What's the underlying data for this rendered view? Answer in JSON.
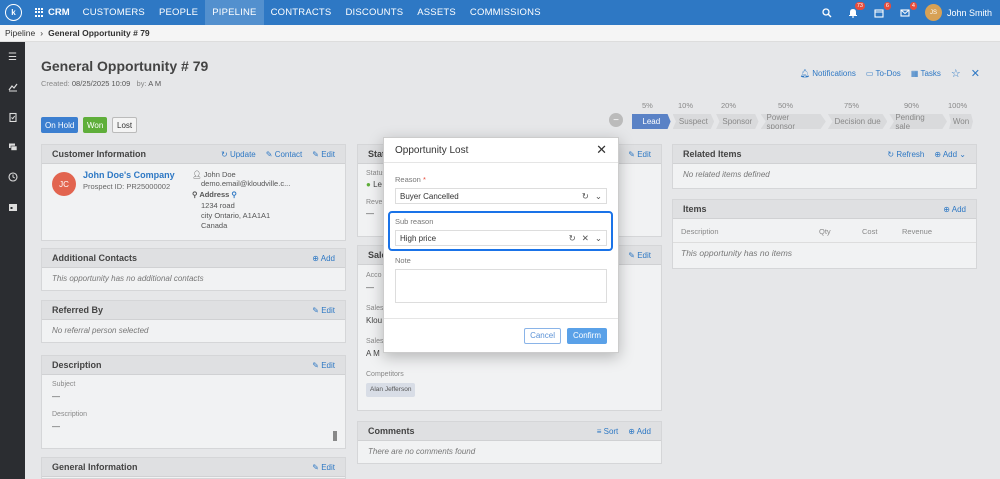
{
  "nav": {
    "logo": "k",
    "brand": "CRM",
    "items": [
      "CUSTOMERS",
      "PEOPLE",
      "PIPELINE",
      "CONTRACTS",
      "DISCOUNTS",
      "ASSETS",
      "COMMISSIONS"
    ],
    "active": "PIPELINE",
    "badges": {
      "notifications": "73",
      "tasks": "6",
      "messages": "4"
    },
    "user_initials": "JS",
    "user_name": "John Smith"
  },
  "breadcrumb": {
    "root": "Pipeline",
    "current": "General Opportunity # 79"
  },
  "header": {
    "title": "General Opportunity # 79",
    "created_label": "Created:",
    "created_date": "08/25/2025 10:09",
    "by_label": "by:",
    "by_user": "A M",
    "actions": {
      "notifications": "Notifications",
      "todos": "To-Dos",
      "tasks": "Tasks"
    }
  },
  "status_buttons": {
    "on_hold": "On Hold",
    "won": "Won",
    "lost": "Lost"
  },
  "stages": {
    "percents": [
      "5%",
      "10%",
      "20%",
      "50%",
      "75%",
      "90%",
      "100%"
    ],
    "labels": [
      "Lead",
      "Suspect",
      "Sponsor",
      "Power sponsor",
      "Decision due",
      "Pending sale",
      "Won"
    ]
  },
  "customer": {
    "title": "Customer Information",
    "update": "Update",
    "contact": "Contact",
    "edit": "Edit",
    "initials": "JC",
    "company": "John Doe's Company",
    "prospect": "Prospect ID: PR25000002",
    "person": "John Doe",
    "email": "demo.email@kloudville.c...",
    "address_label": "Address",
    "address_lines": [
      "1234 road",
      "city Ontario, A1A1A1",
      "Canada"
    ]
  },
  "additional_contacts": {
    "title": "Additional Contacts",
    "add": "Add",
    "empty": "This opportunity has no additional contacts"
  },
  "referred_by": {
    "title": "Referred By",
    "edit": "Edit",
    "empty": "No referral person selected"
  },
  "description": {
    "title": "Description",
    "edit": "Edit",
    "subject_label": "Subject",
    "subject_value": "—",
    "desc_label": "Description",
    "desc_value": "—"
  },
  "general_info": {
    "title": "General Information",
    "edit": "Edit"
  },
  "status_panel": {
    "title": "Stat",
    "edit": "Edit",
    "status_label": "Status",
    "status_value": "Le",
    "revenue_label": "Reve",
    "revenue_value": "—"
  },
  "sales_panel": {
    "title": "Sale",
    "edit": "Edit",
    "account_label": "Acco",
    "account_value": "—",
    "sales1_label": "Sales",
    "sales1_value": "Klou",
    "sales2_label": "Sales",
    "sales2_value": "A M",
    "competitors_label": "Competitors",
    "competitor_chip": "Alan Jefferson"
  },
  "comments": {
    "title": "Comments",
    "sort": "Sort",
    "add": "Add",
    "empty": "There are no comments found"
  },
  "related": {
    "title": "Related Items",
    "refresh": "Refresh",
    "add": "Add",
    "empty": "No related items defined"
  },
  "items": {
    "title": "Items",
    "add": "Add",
    "cols": [
      "Description",
      "Qty",
      "Cost",
      "Revenue"
    ],
    "empty": "This opportunity has no items"
  },
  "modal": {
    "title": "Opportunity Lost",
    "reason_label": "Reason",
    "reason_value": "Buyer Cancelled",
    "subreason_label": "Sub reason",
    "subreason_value": "High price",
    "note_label": "Note",
    "cancel": "Cancel",
    "confirm": "Confirm"
  }
}
